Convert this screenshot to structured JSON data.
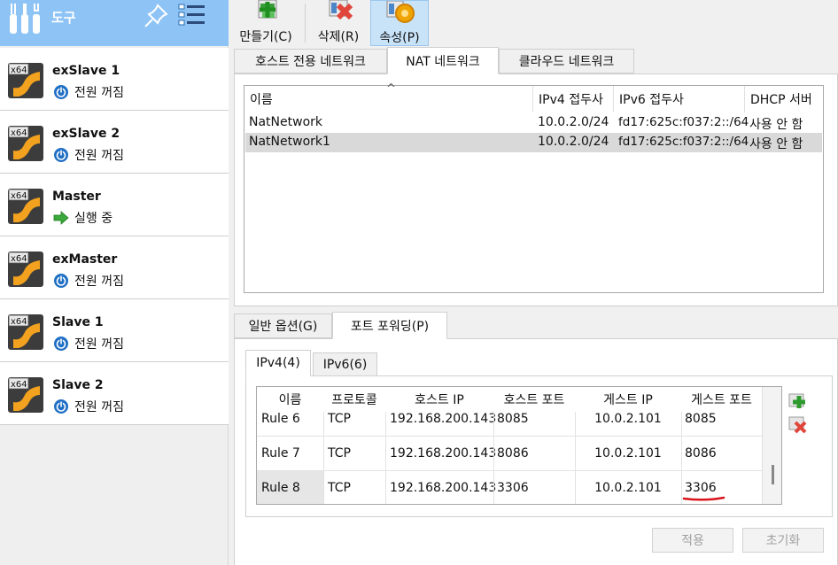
{
  "sidebar": {
    "title": "도구",
    "vms": [
      {
        "name": "exSlave 1",
        "state": "전원 꺼짐",
        "state_icon": "power-icon"
      },
      {
        "name": "exSlave 2",
        "state": "전원 꺼짐",
        "state_icon": "power-icon"
      },
      {
        "name": "Master",
        "state": "실행 중",
        "state_icon": "running-arrow-icon"
      },
      {
        "name": "exMaster",
        "state": "전원 꺼짐",
        "state_icon": "power-icon"
      },
      {
        "name": "Slave 1",
        "state": "전원 꺼짐",
        "state_icon": "power-icon"
      },
      {
        "name": "Slave 2",
        "state": "전원 꺼짐",
        "state_icon": "power-icon"
      }
    ],
    "vm_badge": "x64"
  },
  "toolbar": {
    "create": "만들기(C)",
    "delete": "삭제(R)",
    "properties": "속성(P)"
  },
  "network_tabs": [
    "호스트 전용 네트워크",
    "NAT 네트워크",
    "클라우드 네트워크"
  ],
  "network_table": {
    "headers": [
      "이름",
      "IPv4 접두사",
      "IPv6 접두사",
      "DHCP 서버"
    ],
    "sort_indicator": "^",
    "rows": [
      [
        "NatNetwork",
        "10.0.2.0/24",
        "fd17:625c:f037:2::/64",
        "사용 안 함"
      ],
      [
        "NatNetwork1",
        "10.0.2.0/24",
        "fd17:625c:f037:2::/64",
        "사용 안 함"
      ]
    ],
    "selected_row": 1
  },
  "detail_tabs": [
    "일반 옵션(G)",
    "포트 포워딩(P)"
  ],
  "ip_tabs": [
    "IPv4(4)",
    "IPv6(6)"
  ],
  "rules_table": {
    "headers": [
      "이름",
      "프로토콜",
      "호스트 IP",
      "호스트 포트",
      "게스트 IP",
      "게스트 포트"
    ],
    "rows": [
      [
        "Rule 6",
        "TCP",
        "192.168.200.143",
        "8085",
        "10.0.2.101",
        "8085"
      ],
      [
        "Rule 7",
        "TCP",
        "192.168.200.143",
        "8086",
        "10.0.2.101",
        "8086"
      ],
      [
        "Rule 8",
        "TCP",
        "192.168.200.143",
        "3306",
        "10.0.2.101",
        "3306"
      ]
    ]
  },
  "buttons": {
    "apply": "적용",
    "reset": "초기화"
  },
  "colors": {
    "header_blue": "#8ec3f5",
    "selected_row": "#d9d9d9",
    "annotation_red": "#d9141c"
  }
}
